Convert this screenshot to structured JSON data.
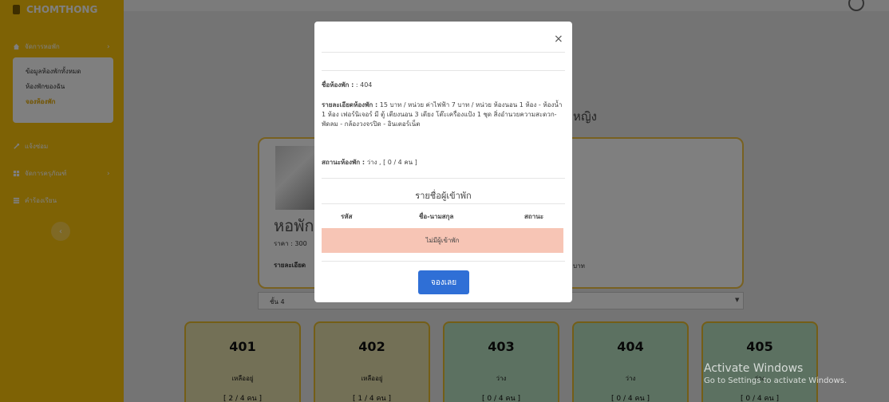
{
  "brand": {
    "title": "CHOMTHONG"
  },
  "sidebar": {
    "menu_title": "จัดการหอพัก",
    "submenu": [
      "ข้อมูลห้องพักทั้งหมด",
      "ห้องพักของฉัน",
      "จองห้องพัก"
    ],
    "items": [
      "แจ้งซ่อม",
      "จัดการครุภัณฑ์",
      "คำร้องเรียน"
    ]
  },
  "main": {
    "heading_fragment": "หญิง",
    "dorm_name_fragment": "หอพัก",
    "price_fragment": "ราคา : 300",
    "detail_fragment": "รายละเอียด",
    "detail_end_fragment": "บาท",
    "floor_select": "ชั้น 4",
    "rooms": [
      {
        "number": "401",
        "status": "เหลืออยู่",
        "capacity": "[ 2 / 4 คน ]"
      },
      {
        "number": "402",
        "status": "เหลืออยู่",
        "capacity": "[ 1 / 4 คน ]"
      },
      {
        "number": "403",
        "status": "ว่าง",
        "capacity": "[ 0 / 4 คน ]"
      },
      {
        "number": "404",
        "status": "ว่าง",
        "capacity": "[ 0 / 4 คน ]"
      },
      {
        "number": "405",
        "status": "ว่าง",
        "capacity": "[ 0 / 4 คน ]"
      }
    ]
  },
  "modal": {
    "close": "×",
    "room_name_label": "ชื่อห้องพัก :",
    "room_name_value": ": 404",
    "detail_label": "รายละเอียดห้องพัก :",
    "detail_value": "15 บาท / หน่วย ค่าไฟฟ้า 7 บาท / หน่วย ห้องนอน 1 ห้อง - ห้องน้ำ 1 ห้อง เฟอร์นิเจอร์ มี ตู้ เตียงนอน 3 เตียง โต๊ะเครื่องแป้ง 1 ชุด สิ่งอำนวยความสะดวก-พัดลม - กล้องวงจรปิด - อินเตอร์เน็ต",
    "status_label": "สถานะห้องพัก :",
    "status_value": "ว่าง , [ 0 / 4 คน ]",
    "tenant_title": "รายชื่อผู้เข้าพัก",
    "columns": [
      "รหัส",
      "ชื่อ-นามสกุล",
      "สถานะ"
    ],
    "empty_text": "ไม่มีผู้เข้าพัก",
    "book_button": "จองเลย"
  },
  "watermark": {
    "line1": "Activate Windows",
    "line2": "Go to Settings to activate Windows."
  },
  "colors": {
    "sidebar": "#fcc40a",
    "room_occupied": "#e7e1ac",
    "room_free": "#b9e2c3",
    "button": "#2f6fd6",
    "empty_row": "#f7c5b5"
  }
}
